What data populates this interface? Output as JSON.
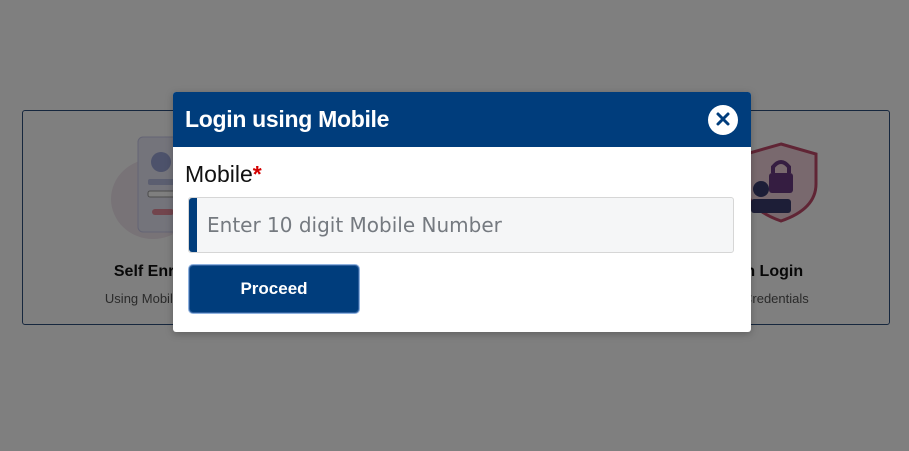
{
  "background": {
    "self_enrol": {
      "title": "Self Enro",
      "subtitle": "Using Mobile N"
    },
    "admin_login": {
      "title": "dmin Login",
      "subtitle": "dmin Credentials"
    }
  },
  "modal": {
    "title": "Login using Mobile",
    "close_icon": "close-icon",
    "mobile_label": "Mobile",
    "required_mark": "*",
    "mobile_placeholder": "Enter 10 digit Mobile Number",
    "mobile_value": "",
    "proceed_label": "Proceed"
  },
  "colors": {
    "primary": "#003d7c",
    "required": "#d40000",
    "overlay": "rgba(0,0,0,0.5)"
  }
}
